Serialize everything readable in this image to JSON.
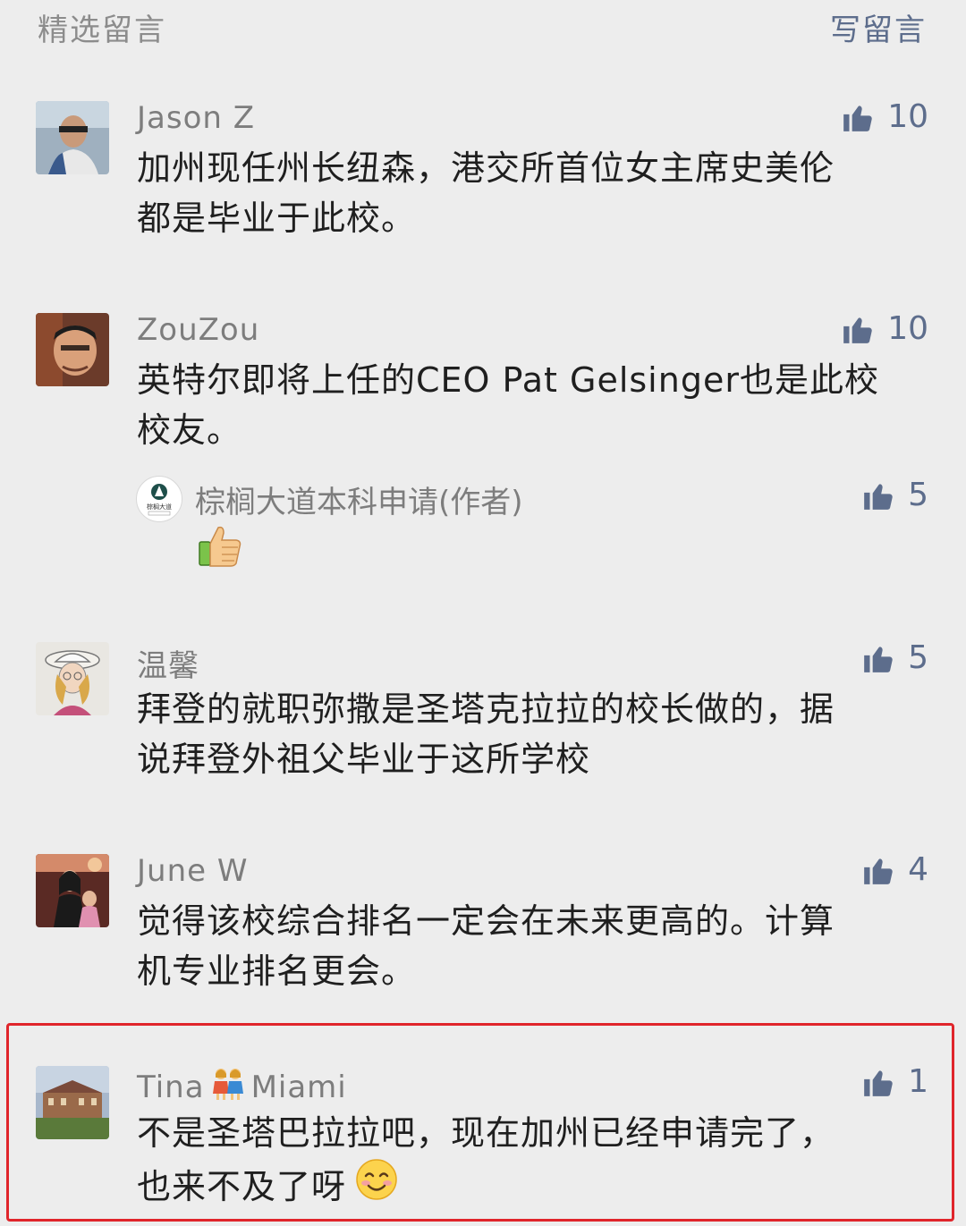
{
  "header": {
    "title": "精选留言",
    "write_label": "写留言"
  },
  "comments": [
    {
      "name": "Jason Z",
      "likes": "10",
      "lines": [
        "加州现任州长纽森，港交所首位女主席史美伦",
        "都是毕业于此校。"
      ]
    },
    {
      "name": "ZouZou",
      "likes": "10",
      "lines": [
        "英特尔即将上任的CEO Pat Gelsinger也是此校",
        "校友。"
      ],
      "reply": {
        "name": "棕榈大道本科申请(作者)",
        "likes": "5",
        "avatar_text": "棕榈大道",
        "content_icon": "thumbs-up-emoji"
      }
    },
    {
      "name": "温馨",
      "likes": "5",
      "lines": [
        "拜登的就职弥撒是圣塔克拉拉的校长做的，据",
        "说拜登外祖父毕业于这所学校"
      ]
    },
    {
      "name": "June W",
      "likes": "4",
      "lines": [
        "觉得该校综合排名一定会在未来更高的。计算",
        "机专业排名更会。"
      ]
    },
    {
      "name_prefix": "Tina",
      "name_suffix": "Miami",
      "name_emoji": "two-women-emoji",
      "likes": "1",
      "lines": [
        "不是圣塔巴拉拉吧，现在加州已经申请完了，",
        "也来不及了呀"
      ],
      "trailing_emoji": "smiling-face-emoji"
    }
  ],
  "colors": {
    "background": "#ededed",
    "link": "#5d6d8c",
    "name": "#7d7d7d",
    "text": "#1f1f1f",
    "highlight": "#e0252b"
  }
}
